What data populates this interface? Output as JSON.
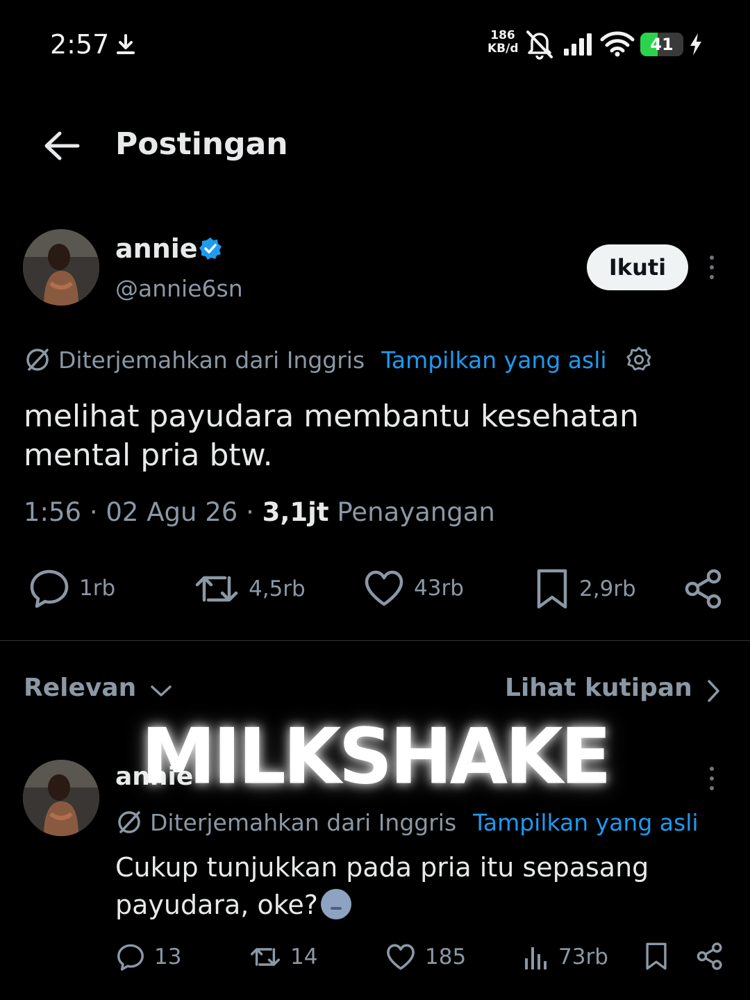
{
  "status_bar": {
    "time": "2:57",
    "net_speed_value": "186",
    "net_speed_unit": "KB/d",
    "battery_level": "41",
    "battery_fraction": 0.41,
    "icons": [
      "download-icon",
      "mute-icon",
      "signal-icon",
      "wifi-icon",
      "battery-icon",
      "charging-icon"
    ]
  },
  "header": {
    "title": "Postingan"
  },
  "post": {
    "author_name": "annie",
    "author_handle": "@annie6sn",
    "follow_label": "Ikuti",
    "translated_from": "Diterjemahkan dari Inggris",
    "show_original": "Tampilkan yang asli",
    "text": "melihat payudara membantu kesehatan mental pria btw.",
    "time": "1:56",
    "date": "02 Agu 26",
    "views_count": "3,1jt",
    "views_label": "Penayangan",
    "actions": {
      "replies": "1rb",
      "reposts": "4,5rb",
      "likes": "43rb",
      "bookmarks": "2,9rb"
    }
  },
  "replies_section": {
    "sort_label": "Relevan",
    "quotes_label": "Lihat kutipan"
  },
  "reply": {
    "author_name": "annie",
    "translated_from": "Diterjemahkan dari Inggris",
    "show_original": "Tampilkan yang asli",
    "text": "Cukup tunjukkan pada pria itu sepasang payudara, oke?",
    "actions": {
      "replies": "13",
      "reposts": "14",
      "likes": "185",
      "views": "73rb"
    }
  },
  "overlay_text": "MILKSHAKE",
  "colors": {
    "background": "#000000",
    "text_primary": "#e7e9ea",
    "text_secondary": "#8b98a5",
    "link": "#1d9bf0",
    "verified": "#1d9bf0",
    "battery": "#2bd24b"
  }
}
